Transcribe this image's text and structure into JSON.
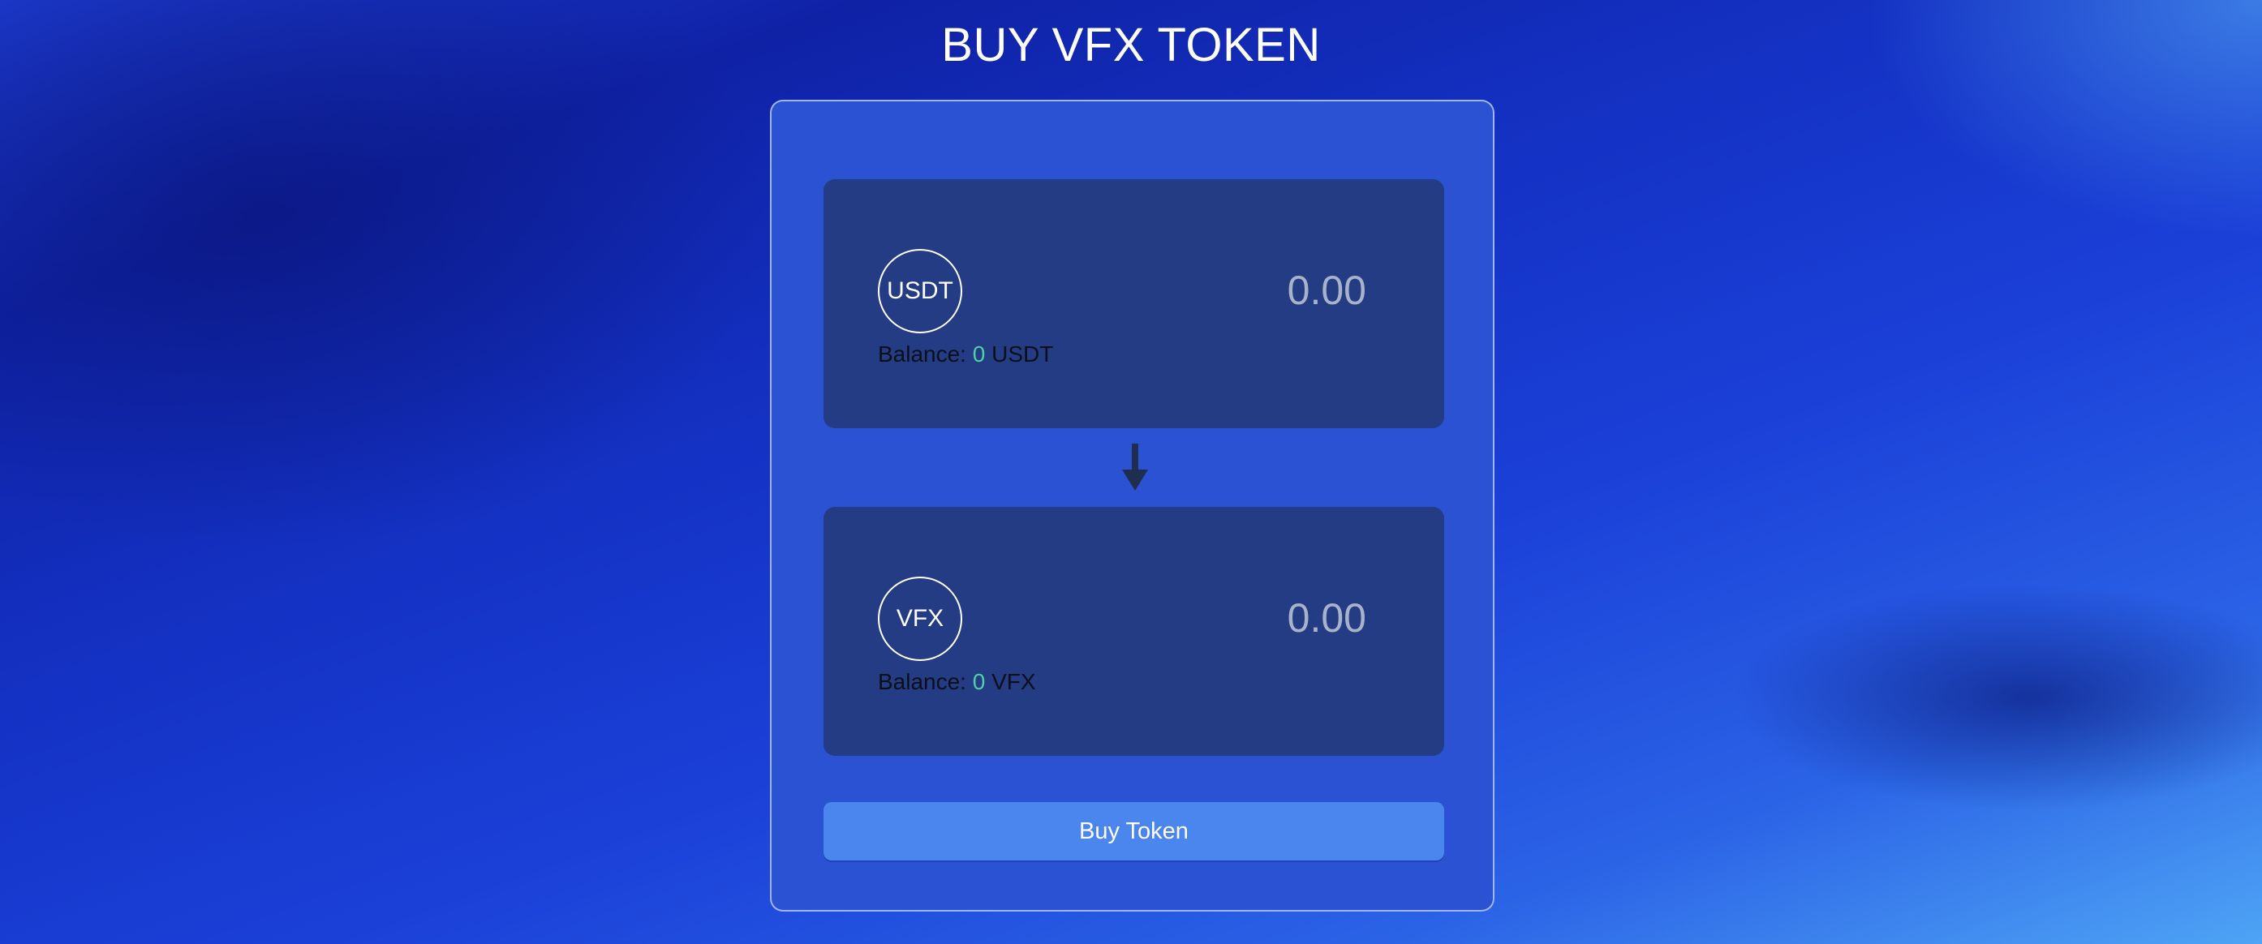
{
  "header": {
    "title": "BUY VFX TOKEN"
  },
  "swap": {
    "from": {
      "token_symbol": "USDT",
      "amount_placeholder": "0.00",
      "balance_label": "Balance:",
      "balance_value": "0",
      "balance_unit": "USDT"
    },
    "arrow_icon": "arrow-down-icon",
    "to": {
      "token_symbol": "VFX",
      "amount_placeholder": "0.00",
      "balance_label": "Balance:",
      "balance_value": "0",
      "balance_unit": "VFX"
    },
    "buy_button_label": "Buy Token"
  },
  "colors": {
    "card_background": "#2a52d2",
    "panel_background": "#233c84",
    "button_background": "#4b86ef",
    "balance_value": "#4fd1a5",
    "amount_placeholder": "#a8b2c8"
  }
}
